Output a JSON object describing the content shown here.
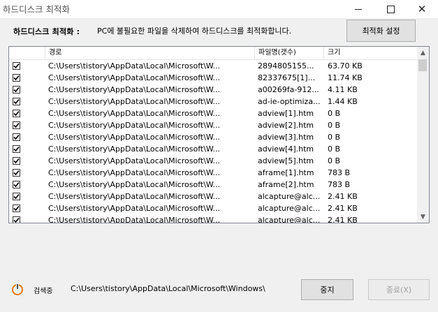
{
  "window": {
    "title": "하드디스크 최적화",
    "min_icon": "minimize-icon",
    "max_icon": "maximize-icon",
    "close_icon": "close-icon"
  },
  "header": {
    "label": "하드디스크 최적화 :",
    "description": "PC에 불필요한 파일을 삭제하여 하드디스크를 최적화합니다.",
    "settings_button": "최적화 설정"
  },
  "table": {
    "columns": [
      "",
      "경로",
      "파일명(갯수)",
      "크기"
    ],
    "rows": [
      {
        "checked": true,
        "path": "C:\\Users\\tistory\\AppData\\Local\\Microsoft\\W...",
        "name": "2894805155...",
        "size": "63.70 KB"
      },
      {
        "checked": true,
        "path": "C:\\Users\\tistory\\AppData\\Local\\Microsoft\\W...",
        "name": "82337675[1]...",
        "size": "11.74 KB"
      },
      {
        "checked": true,
        "path": "C:\\Users\\tistory\\AppData\\Local\\Microsoft\\W...",
        "name": "a00269fa-912...",
        "size": "4.11 KB"
      },
      {
        "checked": true,
        "path": "C:\\Users\\tistory\\AppData\\Local\\Microsoft\\W...",
        "name": "ad-ie-optimiza...",
        "size": "1.44 KB"
      },
      {
        "checked": true,
        "path": "C:\\Users\\tistory\\AppData\\Local\\Microsoft\\W...",
        "name": "adview[1].htm",
        "size": "0 B"
      },
      {
        "checked": true,
        "path": "C:\\Users\\tistory\\AppData\\Local\\Microsoft\\W...",
        "name": "adview[2].htm",
        "size": "0 B"
      },
      {
        "checked": true,
        "path": "C:\\Users\\tistory\\AppData\\Local\\Microsoft\\W...",
        "name": "adview[3].htm",
        "size": "0 B"
      },
      {
        "checked": true,
        "path": "C:\\Users\\tistory\\AppData\\Local\\Microsoft\\W...",
        "name": "adview[4].htm",
        "size": "0 B"
      },
      {
        "checked": true,
        "path": "C:\\Users\\tistory\\AppData\\Local\\Microsoft\\W...",
        "name": "adview[5].htm",
        "size": "0 B"
      },
      {
        "checked": true,
        "path": "C:\\Users\\tistory\\AppData\\Local\\Microsoft\\W...",
        "name": "aframe[1].htm",
        "size": "783 B"
      },
      {
        "checked": true,
        "path": "C:\\Users\\tistory\\AppData\\Local\\Microsoft\\W...",
        "name": "aframe[2].htm",
        "size": "783 B"
      },
      {
        "checked": true,
        "path": "C:\\Users\\tistory\\AppData\\Local\\Microsoft\\W...",
        "name": "alcapture@alc...",
        "size": "2.41 KB"
      },
      {
        "checked": true,
        "path": "C:\\Users\\tistory\\AppData\\Local\\Microsoft\\W...",
        "name": "alcapture@alc...",
        "size": "2.41 KB"
      },
      {
        "checked": true,
        "path": "C:\\Users\\tistory\\AppData\\Local\\Microsoft\\W...",
        "name": "alcapture@alc...",
        "size": "2.41 KB"
      }
    ]
  },
  "status": {
    "icon": "power-icon",
    "label": "검색중",
    "path": "C:\\Users\\tistory\\AppData\\Local\\Microsoft\\Windows\\",
    "stop_button": "중지",
    "exit_button": "종료(X)"
  }
}
